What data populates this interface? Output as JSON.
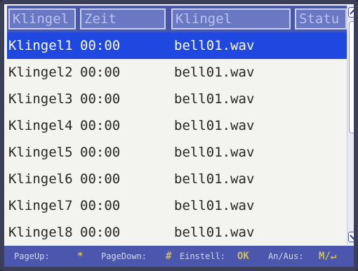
{
  "table": {
    "columns": [
      "Klingel",
      "Zeit",
      "Klingel",
      "Statu"
    ],
    "rows": [
      {
        "name": "Klingel1",
        "time": "00:00",
        "file": "bell01.wav",
        "status_icon": "",
        "selected": true
      },
      {
        "name": "Klingel2",
        "time": "00:00",
        "file": "bell01.wav",
        "status_icon": "",
        "selected": false
      },
      {
        "name": "Klingel3",
        "time": "00:00",
        "file": "bell01.wav",
        "status_icon": "active-dot-icon",
        "selected": false
      },
      {
        "name": "Klingel4",
        "time": "00:00",
        "file": "bell01.wav",
        "status_icon": "",
        "selected": false
      },
      {
        "name": "Klingel5",
        "time": "00:00",
        "file": "bell01.wav",
        "status_icon": "",
        "selected": false
      },
      {
        "name": "Klingel6",
        "time": "00:00",
        "file": "bell01.wav",
        "status_icon": "",
        "selected": false
      },
      {
        "name": "Klingel7",
        "time": "00:00",
        "file": "bell01.wav",
        "status_icon": "",
        "selected": false
      },
      {
        "name": "Klingel8",
        "time": "00:00",
        "file": "bell01.wav",
        "status_icon": "",
        "selected": false
      }
    ]
  },
  "footer": {
    "pageup_label": "PageUp:",
    "pageup_key": "*",
    "pagedown_label": "PageDown:",
    "pagedown_key": "#",
    "einstell_label": "Einstell:",
    "einstell_key": "OK",
    "anaus_label": "An/Aus:",
    "anaus_key": "M/↵"
  },
  "colors": {
    "header_bg": "#4a56a6",
    "selected_row": "#1f48e0",
    "footer_bg": "#4b57ad",
    "key_accent": "#d1bd56"
  }
}
